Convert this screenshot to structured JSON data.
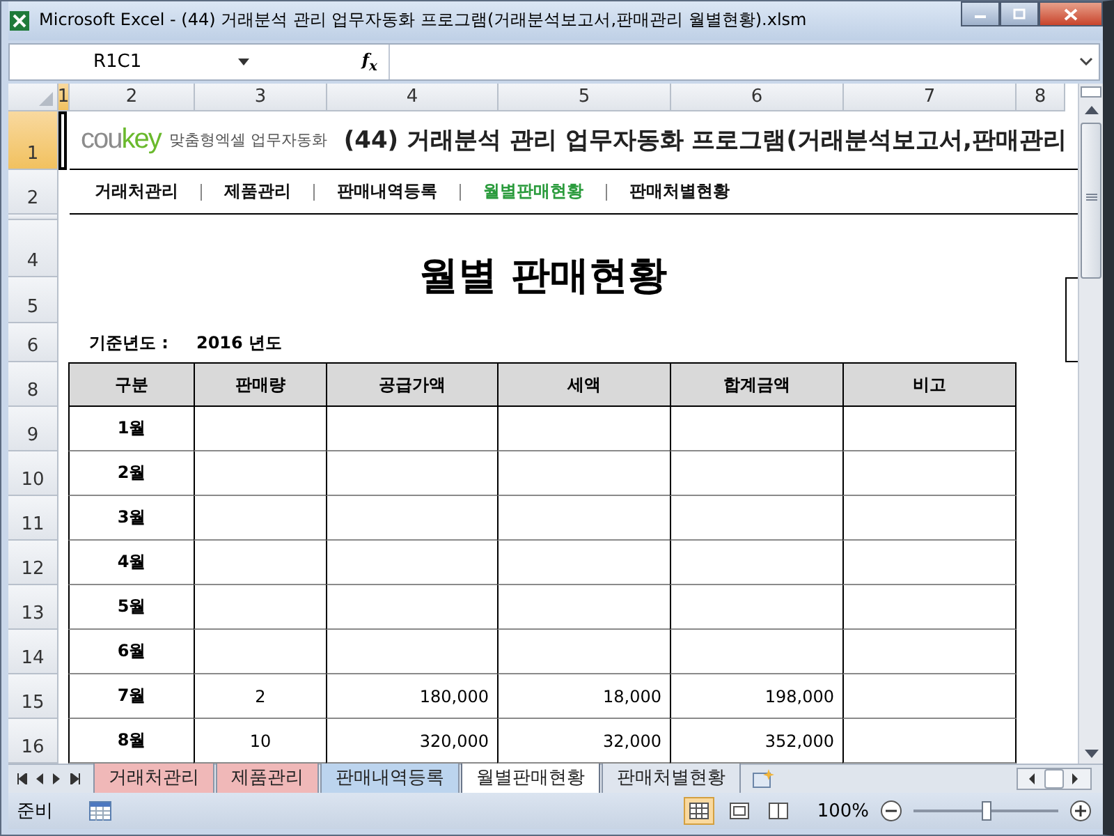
{
  "window": {
    "title": "Microsoft Excel - (44) 거래분석 관리 업무자동화 프로그램(거래분석보고서,판매관리 월별현황).xlsm"
  },
  "formula_bar": {
    "name_box": "R1C1",
    "fx": "f$_{x}$"
  },
  "column_headers": [
    {
      "label": "1",
      "selected": true
    },
    {
      "label": "2",
      "selected": false
    },
    {
      "label": "3",
      "selected": false
    },
    {
      "label": "4",
      "selected": false
    },
    {
      "label": "5",
      "selected": false
    },
    {
      "label": "6",
      "selected": false
    },
    {
      "label": "7",
      "selected": false
    },
    {
      "label": "8",
      "selected": false
    }
  ],
  "row_headers": [
    {
      "label": "1",
      "selected": true
    },
    {
      "label": "2",
      "selected": false
    },
    {
      "label": "4",
      "selected": false
    },
    {
      "label": "5",
      "selected": false
    },
    {
      "label": "6",
      "selected": false
    },
    {
      "label": "8",
      "selected": false
    },
    {
      "label": "9",
      "selected": false
    },
    {
      "label": "10",
      "selected": false
    },
    {
      "label": "11",
      "selected": false
    },
    {
      "label": "12",
      "selected": false
    },
    {
      "label": "13",
      "selected": false
    },
    {
      "label": "14",
      "selected": false
    },
    {
      "label": "15",
      "selected": false
    },
    {
      "label": "16",
      "selected": false
    }
  ],
  "banner": {
    "logo_prefix": "cou",
    "logo_suffix": "key",
    "tagline": "맞춤형엑셀 업무자동화",
    "title": "(44) 거래분석 관리 업무자동화 프로그램(거래분석보고서,판매관리"
  },
  "nav": [
    {
      "label": "거래처관리",
      "selected": false
    },
    {
      "label": "제품관리",
      "selected": false
    },
    {
      "label": "판매내역등록",
      "selected": false
    },
    {
      "label": "월별판매현황",
      "selected": true
    },
    {
      "label": "판매처별현황",
      "selected": false
    }
  ],
  "heading": "월별 판매현황",
  "base_year": {
    "label": "기준년도 :",
    "value": "2016 년도"
  },
  "table": {
    "columns": [
      "구분",
      "판매량",
      "공급가액",
      "세액",
      "합계금액",
      "비고"
    ],
    "rows": [
      [
        "1월",
        "",
        "",
        "",
        "",
        ""
      ],
      [
        "2월",
        "",
        "",
        "",
        "",
        ""
      ],
      [
        "3월",
        "",
        "",
        "",
        "",
        ""
      ],
      [
        "4월",
        "",
        "",
        "",
        "",
        ""
      ],
      [
        "5월",
        "",
        "",
        "",
        "",
        ""
      ],
      [
        "6월",
        "",
        "",
        "",
        "",
        ""
      ],
      [
        "7월",
        "2",
        "180,000",
        "18,000",
        "198,000",
        ""
      ],
      [
        "8월",
        "10",
        "320,000",
        "32,000",
        "352,000",
        ""
      ]
    ]
  },
  "sheet_tabs": [
    {
      "label": "거래처관리",
      "selected": false,
      "color": "#f0b8b8"
    },
    {
      "label": "제품관리",
      "selected": false,
      "color": "#f0b8b8"
    },
    {
      "label": "판매내역등록",
      "selected": false,
      "color": "#bcd4ee"
    },
    {
      "label": "월별판매현황",
      "selected": true,
      "color": "#ffffff"
    },
    {
      "label": "판매처별현황",
      "selected": false,
      "color": "#dfe5ee"
    }
  ],
  "status_bar": {
    "status": "준비",
    "zoom": "100%",
    "zoom_slider": {
      "level": 0.5
    }
  }
}
